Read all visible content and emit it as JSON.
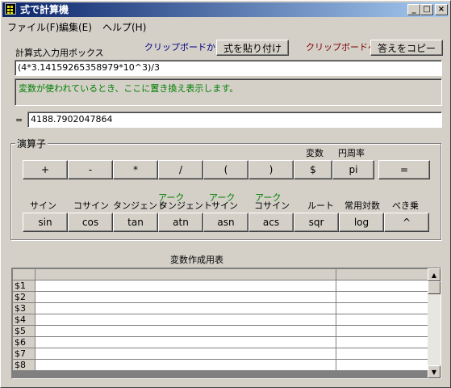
{
  "window": {
    "title": "式で計算機",
    "minimize_glyph": "_",
    "maximize_glyph": "□",
    "close_glyph": "×"
  },
  "menu": [
    "ファイル(F)",
    "編集(E)",
    "ヘルプ(H)"
  ],
  "input_section": {
    "label": "計算式入力用ボックス",
    "clipboard_from_label": "クリップボードから",
    "paste_button": "式を貼り付け",
    "clipboard_to_label": "クリップボードへ",
    "copy_button": "答えをコピー",
    "expression": "(4*3.14159265358979*10^3)/3",
    "message": "変数が使われているとき、ここに置き換え表示します。",
    "equals_sign": "=",
    "result": "4188.7902047864"
  },
  "operators": {
    "group_title": "演算子",
    "row1_labels": {
      "variable": "変数",
      "pi": "円周率"
    },
    "row1": [
      "+",
      "-",
      "*",
      "/",
      "(",
      ")",
      "$",
      "pi"
    ],
    "equals_button": "=",
    "row2_labels": [
      "サイン",
      "コサイン",
      "タンジェント",
      "タンジェント",
      "サイン",
      "コサイン",
      "ルート",
      "常用対数",
      "べき乗"
    ],
    "arc_label": "アーク",
    "row2": [
      "sin",
      "cos",
      "tan",
      "atn",
      "asn",
      "acs",
      "sqr",
      "log",
      "^"
    ]
  },
  "variable_table": {
    "title": "変数作成用表",
    "rows": [
      "$1",
      "$2",
      "$3",
      "$4",
      "$5",
      "$6",
      "$7",
      "$8"
    ]
  },
  "colors": {
    "title_gradient_start": "#0a246a",
    "title_gradient_end": "#a6caf0",
    "clipboard_from_color": "#000080",
    "clipboard_to_color": "#800000",
    "message_color": "#008000"
  }
}
